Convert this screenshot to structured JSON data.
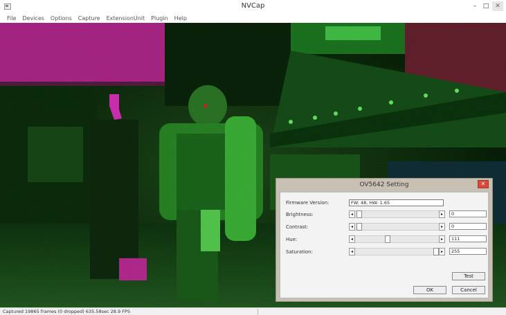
{
  "window": {
    "title": "NVCap",
    "minimize": "–",
    "maximize": "□",
    "close": "✕"
  },
  "menu": [
    "File",
    "Devices",
    "Options",
    "Capture",
    "ExtensionUnit",
    "Plugin",
    "Help"
  ],
  "status": {
    "text": "Captured 19865 frames (0 dropped) 635.58sec 28.9 FPS"
  },
  "dialog": {
    "title": "OV5642 Setting",
    "close": "✕",
    "firmware": {
      "label": "Firmware Version:",
      "value": "FW: 48, HW: 1.65"
    },
    "sliders": [
      {
        "label": "Brightness:",
        "value": "0",
        "position": 0.02
      },
      {
        "label": "Contrast:",
        "value": "0",
        "position": 0.02
      },
      {
        "label": "Hue:",
        "value": "111",
        "position": 0.38
      },
      {
        "label": "Saturation:",
        "value": "255",
        "position": 1.0
      }
    ],
    "buttons": {
      "test": "Test",
      "ok": "OK",
      "cancel": "Cancel"
    }
  },
  "colors": {
    "accent_close": "#d94a3a",
    "video_green": "#2f8a2a",
    "video_magenta": "#c81fa8"
  },
  "icons": {
    "arrow_left": "◂",
    "arrow_right": "▸"
  }
}
